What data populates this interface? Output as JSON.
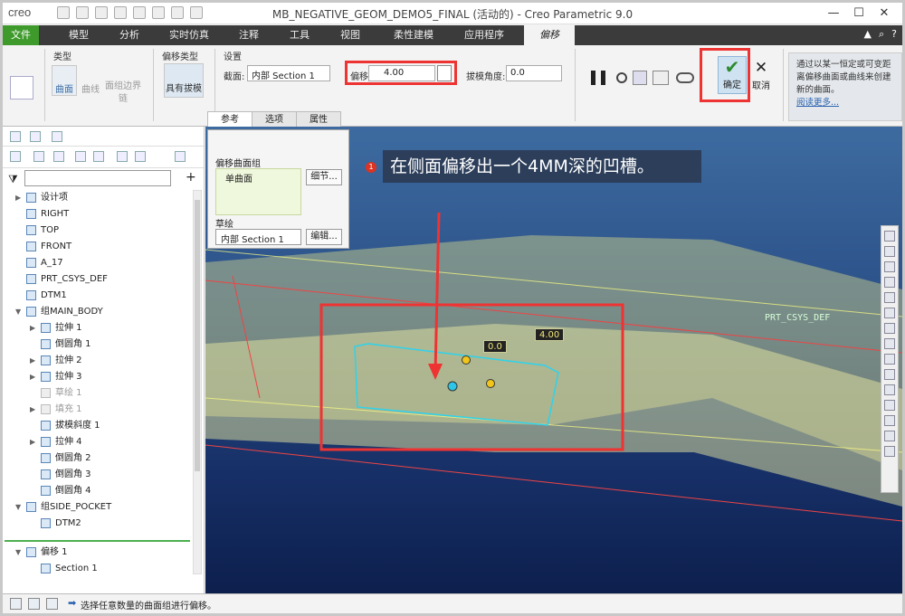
{
  "window": {
    "logo": "creo",
    "title": "MB_NEGATIVE_GEOM_DEMO5_FINAL (活动的) - Creo Parametric 9.0"
  },
  "tabs": [
    {
      "label": "文件"
    },
    {
      "label": "模型"
    },
    {
      "label": "分析"
    },
    {
      "label": "实时仿真"
    },
    {
      "label": "注释"
    },
    {
      "label": "工具"
    },
    {
      "label": "视图"
    },
    {
      "label": "柔性建模"
    },
    {
      "label": "应用程序"
    },
    {
      "label": "偏移"
    }
  ],
  "ribbon": {
    "type_group": "类型",
    "type_surface": "曲面",
    "type_curve": "曲线",
    "type_boundary": "面组边界链",
    "offset_type_group": "偏移类型",
    "offset_type_value": "具有拔模",
    "settings_group": "设置",
    "section_label": "截面:",
    "section_value": "内部 Section 1",
    "offset_label": "偏移:",
    "offset_value": "4.00",
    "draft_label": "拔模角度:",
    "draft_value": "0.0",
    "ok_label": "确定",
    "cancel_label": "取消",
    "cancel_glyph": "✕",
    "info_text": "通过以某一恒定或可变距离偏移曲面或曲线来创建新的曲面。",
    "info_link": "阅读更多..."
  },
  "subtabs": [
    "参考",
    "选项",
    "属性"
  ],
  "panel": {
    "surface_group_label": "偏移曲面组",
    "surface_group_value": "单曲面",
    "details_button": "细节...",
    "sketch_label": "草绘",
    "sketch_value": "内部 Section 1",
    "edit_button": "编辑..."
  },
  "tree": [
    {
      "label": "设计项",
      "indent": 0,
      "expand": "▶",
      "dim": false
    },
    {
      "label": "RIGHT",
      "indent": 0,
      "expand": "",
      "dim": false
    },
    {
      "label": "TOP",
      "indent": 0,
      "expand": "",
      "dim": false
    },
    {
      "label": "FRONT",
      "indent": 0,
      "expand": "",
      "dim": false
    },
    {
      "label": "A_17",
      "indent": 0,
      "expand": "",
      "dim": false
    },
    {
      "label": "PRT_CSYS_DEF",
      "indent": 0,
      "expand": "",
      "dim": false
    },
    {
      "label": "DTM1",
      "indent": 0,
      "expand": "",
      "dim": false
    },
    {
      "label": "组MAIN_BODY",
      "indent": 0,
      "expand": "▼",
      "dim": false
    },
    {
      "label": "拉伸 1",
      "indent": 1,
      "expand": "▶",
      "dim": false
    },
    {
      "label": "倒圆角 1",
      "indent": 1,
      "expand": "",
      "dim": false
    },
    {
      "label": "拉伸 2",
      "indent": 1,
      "expand": "▶",
      "dim": false
    },
    {
      "label": "拉伸 3",
      "indent": 1,
      "expand": "▶",
      "dim": false
    },
    {
      "label": "草绘 1",
      "indent": 1,
      "expand": "",
      "dim": true
    },
    {
      "label": "填充 1",
      "indent": 1,
      "expand": "▶",
      "dim": true
    },
    {
      "label": "拔模斜度 1",
      "indent": 1,
      "expand": "",
      "dim": false
    },
    {
      "label": "拉伸 4",
      "indent": 1,
      "expand": "▶",
      "dim": false
    },
    {
      "label": "倒圆角 2",
      "indent": 1,
      "expand": "",
      "dim": false
    },
    {
      "label": "倒圆角 3",
      "indent": 1,
      "expand": "",
      "dim": false
    },
    {
      "label": "倒圆角 4",
      "indent": 1,
      "expand": "",
      "dim": false
    },
    {
      "label": "组SIDE_POCKET",
      "indent": 0,
      "expand": "▼",
      "dim": false
    },
    {
      "label": "DTM2",
      "indent": 1,
      "expand": "",
      "dim": false
    }
  ],
  "tree_active": [
    {
      "label": "偏移 1",
      "indent": 0,
      "expand": "▼"
    },
    {
      "label": "Section 1",
      "indent": 1,
      "expand": ""
    }
  ],
  "viewport": {
    "callout_number": "1",
    "callout_text": "在侧面偏移出一个4MM深的凹槽。",
    "dim_offset": "4.00",
    "dim_draft": "0.0",
    "csys_label": "PRT_CSYS_DEF"
  },
  "status": {
    "message": "选择任意数量的曲面组进行偏移。"
  }
}
